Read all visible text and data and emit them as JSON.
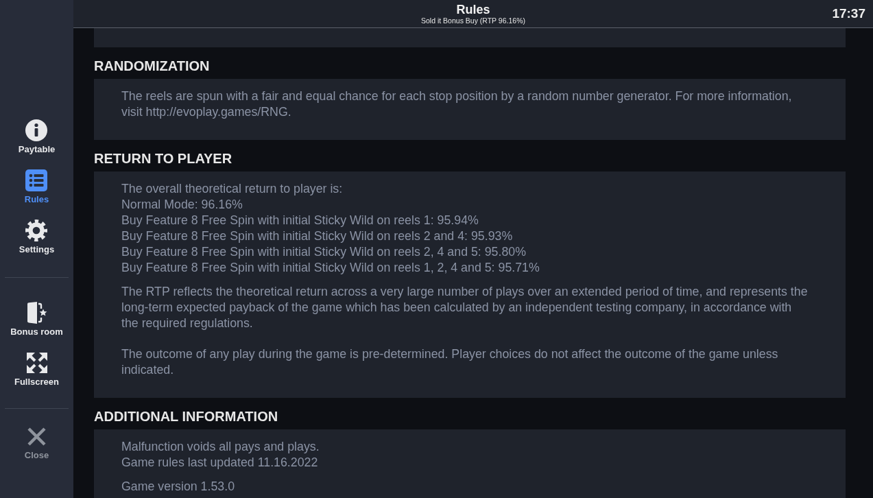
{
  "header": {
    "title": "Rules",
    "subtitle": "Sold it Bonus Buy (RTP 96.16%)",
    "time": "17:37"
  },
  "sidebar": {
    "groups": [
      {
        "items": [
          {
            "kind": "paytable",
            "label": "Paytable",
            "selected": false
          },
          {
            "kind": "rules",
            "label": "Rules",
            "selected": true
          },
          {
            "kind": "settings",
            "label": "Settings",
            "selected": false
          }
        ]
      },
      {
        "items": [
          {
            "kind": "bonus_room",
            "label": "Bonus room",
            "selected": false
          },
          {
            "kind": "fullscreen",
            "label": "Fullscreen",
            "selected": false
          }
        ]
      },
      {
        "items": [
          {
            "kind": "close",
            "label": "Close",
            "selected": false
          }
        ]
      }
    ]
  },
  "sections": [
    {
      "heading": "RANDOMIZATION",
      "blocks": [
        {
          "kind": "paragraphs",
          "paragraphs": [
            "The reels are spun with a fair and equal chance for each stop position by a random number generator. For more information, visit http://evoplay.games/RNG."
          ]
        }
      ]
    },
    {
      "heading": "RETURN TO PLAYER",
      "blocks": [
        {
          "kind": "lines",
          "lines": [
            "The overall theoretical return to player is:",
            "Normal Mode: 96.16%",
            "Buy Feature 8 Free Spin with initial Sticky Wild on reels 1: 95.94%",
            "Buy Feature 8 Free Spin with initial Sticky Wild on reels 2 and 4: 95.93%",
            "Buy Feature 8 Free Spin with initial Sticky Wild on reels 2, 4 and 5: 95.80%",
            "Buy Feature 8 Free Spin with initial Sticky Wild on reels 1, 2, 4 and 5: 95.71%"
          ]
        },
        {
          "kind": "paragraphs",
          "paragraphs": [
            "The RTP reflects the theoretical return across a very large number of plays over an extended period of time, and represents the long-term expected payback of the game which has been calculated by an independent testing company, in accordance with the required regulations.",
            "The outcome of any play during the game is pre-determined. Player choices do not affect the outcome of the game unless indicated."
          ]
        }
      ]
    },
    {
      "heading": "ADDITIONAL INFORMATION",
      "blocks": [
        {
          "kind": "lines",
          "lines": [
            "Malfunction voids all pays and plays.",
            "Game rules last updated 11.16.2022"
          ]
        },
        {
          "kind": "lines",
          "lines": [
            "Game version 1.53.0"
          ]
        }
      ]
    }
  ]
}
